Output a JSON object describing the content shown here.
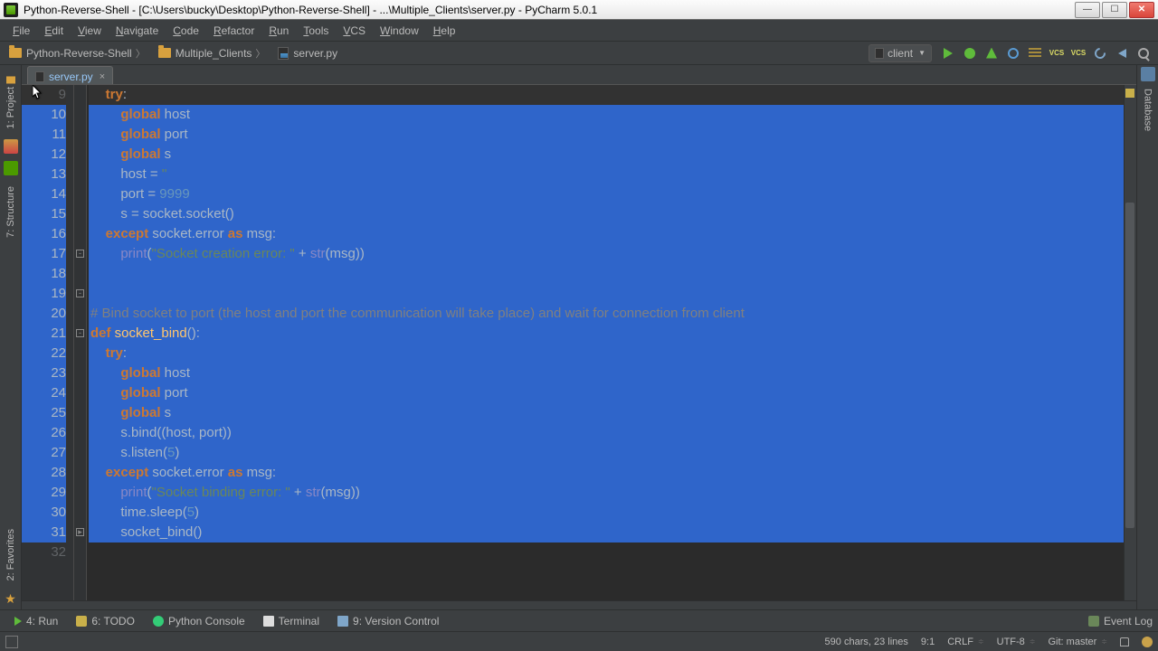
{
  "window": {
    "title": "Python-Reverse-Shell - [C:\\Users\\bucky\\Desktop\\Python-Reverse-Shell] - ...\\Multiple_Clients\\server.py - PyCharm 5.0.1"
  },
  "menu": [
    "File",
    "Edit",
    "View",
    "Navigate",
    "Code",
    "Refactor",
    "Run",
    "Tools",
    "VCS",
    "Window",
    "Help"
  ],
  "breadcrumb": [
    {
      "type": "folder",
      "label": "Python-Reverse-Shell"
    },
    {
      "type": "folder",
      "label": "Multiple_Clients"
    },
    {
      "type": "file",
      "label": "server.py"
    }
  ],
  "run_config": "client",
  "side_tabs_left": [
    {
      "name": "project",
      "label": "1: Project"
    },
    {
      "name": "structure",
      "label": "7: Structure"
    },
    {
      "name": "favorites",
      "label": "2: Favorites"
    }
  ],
  "side_tabs_right": [
    {
      "name": "database",
      "label": "Database"
    }
  ],
  "file_tab": "server.py",
  "code": {
    "first_line_no": 9,
    "lines": [
      {
        "sel": false,
        "tokens": [
          [
            "    ",
            "txt"
          ],
          [
            "try",
            "kw"
          ],
          [
            ":",
            "txt"
          ]
        ]
      },
      {
        "sel": true,
        "tokens": [
          [
            "        ",
            "txt"
          ],
          [
            "global",
            "kw"
          ],
          [
            " host",
            "txt"
          ]
        ]
      },
      {
        "sel": true,
        "tokens": [
          [
            "        ",
            "txt"
          ],
          [
            "global",
            "kw"
          ],
          [
            " port",
            "txt"
          ]
        ]
      },
      {
        "sel": true,
        "tokens": [
          [
            "        ",
            "txt"
          ],
          [
            "global",
            "kw"
          ],
          [
            " s",
            "txt"
          ]
        ]
      },
      {
        "sel": true,
        "tokens": [
          [
            "        host = ",
            "txt"
          ],
          [
            "''",
            "str"
          ]
        ]
      },
      {
        "sel": true,
        "tokens": [
          [
            "        port = ",
            "txt"
          ],
          [
            "9999",
            "num"
          ]
        ]
      },
      {
        "sel": true,
        "tokens": [
          [
            "        s = socket.socket()",
            "txt"
          ]
        ]
      },
      {
        "sel": true,
        "tokens": [
          [
            "    ",
            "txt"
          ],
          [
            "except",
            "kw"
          ],
          [
            " socket.error ",
            "txt"
          ],
          [
            "as",
            "kw"
          ],
          [
            " msg:",
            "txt"
          ]
        ]
      },
      {
        "sel": true,
        "tokens": [
          [
            "        ",
            "txt"
          ],
          [
            "print",
            "bfn"
          ],
          [
            "(",
            "txt"
          ],
          [
            "\"Socket creation error: \"",
            "str"
          ],
          [
            " + ",
            "txt"
          ],
          [
            "str",
            "bfn"
          ],
          [
            "(msg))",
            "txt"
          ]
        ]
      },
      {
        "sel": true,
        "tokens": [
          [
            "",
            "txt"
          ]
        ]
      },
      {
        "sel": true,
        "tokens": [
          [
            "",
            "txt"
          ]
        ]
      },
      {
        "sel": true,
        "tokens": [
          [
            "# Bind socket to port (the host and port the communication will take place) and wait for connection from client",
            "cmt"
          ]
        ]
      },
      {
        "sel": true,
        "tokens": [
          [
            "def ",
            "kw"
          ],
          [
            "socket_bind",
            "fn"
          ],
          [
            "():",
            "txt"
          ]
        ]
      },
      {
        "sel": true,
        "tokens": [
          [
            "    ",
            "txt"
          ],
          [
            "try",
            "kw"
          ],
          [
            ":",
            "txt"
          ]
        ]
      },
      {
        "sel": true,
        "tokens": [
          [
            "        ",
            "txt"
          ],
          [
            "global",
            "kw"
          ],
          [
            " host",
            "txt"
          ]
        ]
      },
      {
        "sel": true,
        "tokens": [
          [
            "        ",
            "txt"
          ],
          [
            "global",
            "kw"
          ],
          [
            " port",
            "txt"
          ]
        ]
      },
      {
        "sel": true,
        "tokens": [
          [
            "        ",
            "txt"
          ],
          [
            "global",
            "kw"
          ],
          [
            " s",
            "txt"
          ]
        ]
      },
      {
        "sel": true,
        "tokens": [
          [
            "        s.bind((host, port))",
            "txt"
          ]
        ]
      },
      {
        "sel": true,
        "tokens": [
          [
            "        s.listen(",
            "txt"
          ],
          [
            "5",
            "num"
          ],
          [
            ")",
            "txt"
          ]
        ]
      },
      {
        "sel": true,
        "tokens": [
          [
            "    ",
            "txt"
          ],
          [
            "except",
            "kw"
          ],
          [
            " socket.error ",
            "txt"
          ],
          [
            "as",
            "kw"
          ],
          [
            " msg:",
            "txt"
          ]
        ]
      },
      {
        "sel": true,
        "tokens": [
          [
            "        ",
            "txt"
          ],
          [
            "print",
            "bfn"
          ],
          [
            "(",
            "txt"
          ],
          [
            "\"Socket binding error: \"",
            "str"
          ],
          [
            " + ",
            "txt"
          ],
          [
            "str",
            "bfn"
          ],
          [
            "(msg))",
            "txt"
          ]
        ]
      },
      {
        "sel": true,
        "tokens": [
          [
            "        time.sleep(",
            "txt"
          ],
          [
            "5",
            "num"
          ],
          [
            ")",
            "txt"
          ]
        ]
      },
      {
        "sel": true,
        "tokens": [
          [
            "        socket_bind()",
            "txt"
          ]
        ]
      },
      {
        "sel": false,
        "tokens": [
          [
            "",
            "txt"
          ]
        ]
      }
    ]
  },
  "bottom_tabs": [
    {
      "name": "run",
      "label": "4: Run",
      "icon": "tri"
    },
    {
      "name": "todo",
      "label": "6: TODO",
      "icon": "todo"
    },
    {
      "name": "python-console",
      "label": "Python Console",
      "icon": "pycon"
    },
    {
      "name": "terminal",
      "label": "Terminal",
      "icon": "term"
    },
    {
      "name": "version-control",
      "label": "9: Version Control",
      "icon": "vc"
    }
  ],
  "event_log_label": "Event Log",
  "status": {
    "chars": "590 chars, 23 lines",
    "pos": "9:1",
    "linesep": "CRLF",
    "encoding": "UTF-8",
    "git": "Git: master"
  }
}
